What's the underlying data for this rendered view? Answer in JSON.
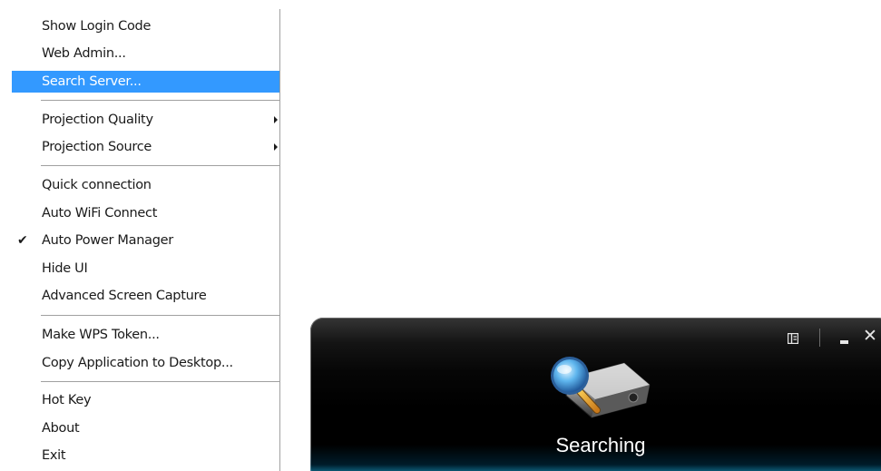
{
  "menu": {
    "items": [
      {
        "label": "Show Login Code"
      },
      {
        "label": "Web Admin..."
      },
      {
        "label": "Search Server...",
        "selected": true
      },
      {
        "label": "Projection Quality",
        "submenu": true
      },
      {
        "label": "Projection Source",
        "submenu": true
      },
      {
        "label": "Quick connection"
      },
      {
        "label": "Auto WiFi Connect"
      },
      {
        "label": "Auto Power Manager",
        "checked": true
      },
      {
        "label": "Hide UI"
      },
      {
        "label": "Advanced Screen Capture"
      },
      {
        "label": "Make WPS Token..."
      },
      {
        "label": "Copy Application to Desktop..."
      },
      {
        "label": "Hot Key"
      },
      {
        "label": "About"
      },
      {
        "label": "Exit"
      }
    ],
    "check_glyph": "✔"
  },
  "widget": {
    "status": "Searching",
    "close_glyph": "✕",
    "icons": [
      "panel-toggle-icon",
      "minimize-icon",
      "close-icon",
      "projector-search-icon"
    ]
  },
  "colors": {
    "selection": "#3399ff",
    "glow": "#1ebef0"
  }
}
